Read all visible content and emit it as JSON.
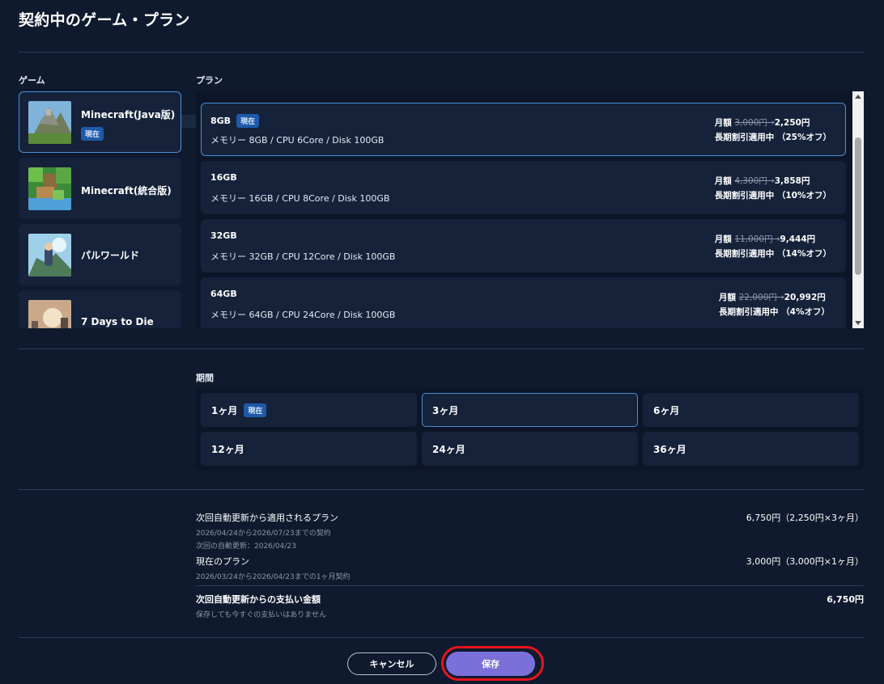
{
  "title": "契約中のゲーム・プラン",
  "labels": {
    "game": "ゲーム",
    "plan": "プラン",
    "period": "期間"
  },
  "current_badge": "現在",
  "games": [
    {
      "name": "Minecraft(Java版)",
      "current": true,
      "selected": true
    },
    {
      "name": "Minecraft(統合版)",
      "current": false,
      "selected": false
    },
    {
      "name": "パルワールド",
      "current": false,
      "selected": false
    },
    {
      "name": "7 Days to Die",
      "current": false,
      "selected": false
    }
  ],
  "plans": [
    {
      "name": "8GB",
      "current": true,
      "spec": "メモリー 8GB / CPU 6Core / Disk 100GB",
      "price_prefix": "月額",
      "old_price": "3,000円",
      "arrow": "→",
      "new_price": "2,250円",
      "discount": "長期割引適用中 （25%オフ）"
    },
    {
      "name": "16GB",
      "current": false,
      "spec": "メモリー 16GB / CPU 8Core / Disk 100GB",
      "price_prefix": "月額",
      "old_price": "4,300円",
      "arrow": "→",
      "new_price": "3,858円",
      "discount": "長期割引適用中 （10%オフ）"
    },
    {
      "name": "32GB",
      "current": false,
      "spec": "メモリー 32GB / CPU 12Core / Disk 100GB",
      "price_prefix": "月額",
      "old_price": "11,000円",
      "arrow": "→",
      "new_price": "9,444円",
      "discount": "長期割引適用中 （14%オフ）"
    },
    {
      "name": "64GB",
      "current": false,
      "spec": "メモリー 64GB / CPU 24Core / Disk 100GB",
      "price_prefix": "月額",
      "old_price": "22,000円",
      "arrow": "→",
      "new_price": "20,992円",
      "discount": "長期割引適用中 （4%オフ）"
    }
  ],
  "periods": [
    {
      "label": "1ヶ月",
      "current": true,
      "selected": false
    },
    {
      "label": "3ヶ月",
      "current": false,
      "selected": true
    },
    {
      "label": "6ヶ月",
      "current": false,
      "selected": false
    },
    {
      "label": "12ヶ月",
      "current": false,
      "selected": false
    },
    {
      "label": "24ヶ月",
      "current": false,
      "selected": false
    },
    {
      "label": "36ヶ月",
      "current": false,
      "selected": false
    }
  ],
  "summary": {
    "next_plan_title": "次回自動更新から適用されるプラン",
    "next_plan_period": "2026/04/24から2026/07/23までの契約",
    "next_plan_renewal": "次回の自動更新：2026/04/23",
    "next_plan_value": "6,750円（2,250円×3ヶ月）",
    "current_plan_title": "現在のプラン",
    "current_plan_period": "2026/03/24から2026/04/23までの1ヶ月契約",
    "current_plan_value": "3,000円（3,000円×1ヶ月）",
    "total_title": "次回自動更新からの支払い金額",
    "total_note": "保存しても今すぐの支払いはありません",
    "total_value": "6,750円"
  },
  "buttons": {
    "cancel": "キャンセル",
    "save": "保存"
  },
  "colors": {
    "background": "#0f1a2e",
    "card": "#15223a",
    "selected_border": "#4a8fd6",
    "badge": "#1e5aa8",
    "save": "#7b6fd9",
    "highlight_ring": "#e8141c"
  }
}
